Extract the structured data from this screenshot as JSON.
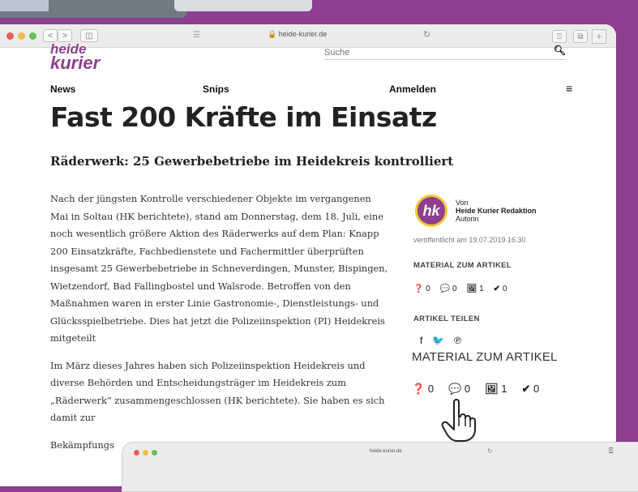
{
  "browser": {
    "url": "heide-kurier.de",
    "nav_back": "<",
    "nav_forward": ">",
    "sidebar": "◫",
    "reload": "↻",
    "share": "⍐",
    "tabs": "⧉",
    "newtab": "+"
  },
  "site": {
    "logo_line1": "heide",
    "logo_line2": "kurier",
    "search_placeholder": "Suche",
    "nav": [
      "News",
      "Snips",
      "Anmelden"
    ]
  },
  "article": {
    "title": "Fast 200 Kräfte im Einsatz",
    "subtitle": "Räderwerk: 25 Gewerbebetriebe im Heidekreis kontrolliert",
    "paragraphs": [
      "Nach der jüngsten Kontrolle verschiedener Objekte im vergangenen Mai in Soltau (HK berichtete), stand am Donnerstag, dem 18. Juli, eine noch wesentlich größere Aktion des Räderwerks auf dem Plan: Knapp 200 Einsatzkräfte, Fachbedienstete und Fachermittler überprüften insgesamt 25 Gewerbebetriebe in Schneverdingen, Munster, Bispingen, Wietzendorf, Bad Fallingbostel und Walsrode. Betroffen von den Maßnahmen waren in erster Linie Gastronomie-, Dienstleistungs- und Glücksspielbetriebe. Dies hat jetzt die Polizeiinspektion (PI) Heidekreis mitgeteilt",
      "Im März dieses Jahres haben sich Polizeiinspektion Heidekreis und diverse Behörden und Entscheidungsträger im Heidekreis zum „Räderwerk“ zusammengeschlossen (HK berichtete). Sie haben es sich damit zur",
      "Bekämpfungs"
    ]
  },
  "sidebar": {
    "avatar_text": "hk",
    "von": "Von",
    "author_name": "Heide Kurier Redaktion",
    "author_role": "Autorin",
    "published": "veröffentlicht am 19.07.2019 16:30",
    "material_label": "MATERIAL ZUM ARTIKEL",
    "counters": [
      {
        "icon": "❓",
        "value": "0"
      },
      {
        "icon": "💬",
        "value": "0"
      },
      {
        "icon": "🖼",
        "value": "1"
      },
      {
        "icon": "✔",
        "value": "0"
      }
    ],
    "share_label": "ARTIKEL TEILEN",
    "social": [
      "f",
      "🐦",
      "℗"
    ]
  },
  "zoom": {
    "material_label": "MATERIAL ZUM ARTIKEL",
    "counters": [
      {
        "icon": "❓",
        "value": "0"
      },
      {
        "icon": "💬",
        "value": "0"
      },
      {
        "icon": "🖼",
        "value": "1"
      },
      {
        "icon": "✔",
        "value": "0"
      }
    ]
  },
  "window2": {
    "url": "heide-kurier.de"
  },
  "colors": {
    "brand": "#8e3f8f",
    "avatar_ring": "#f0c93a"
  }
}
